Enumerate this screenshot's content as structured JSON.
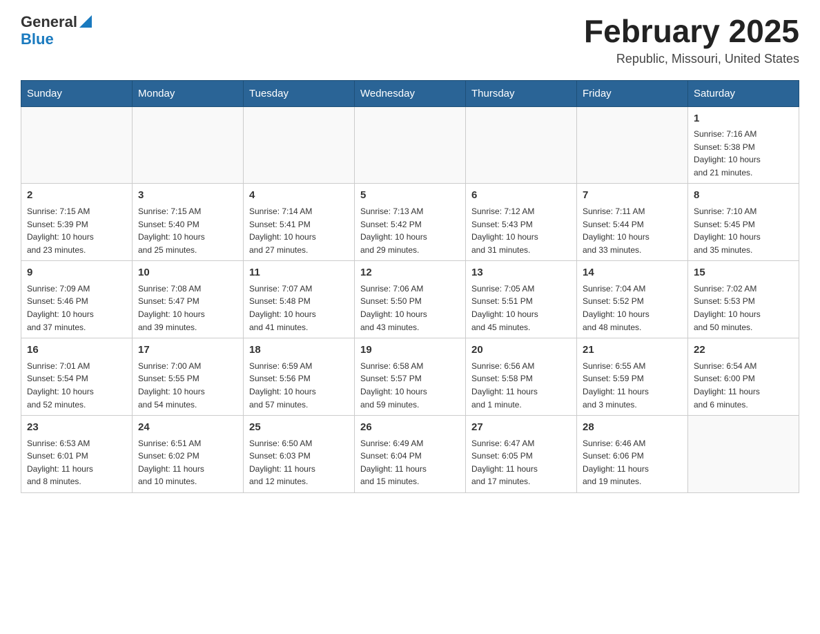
{
  "header": {
    "logo_general": "General",
    "logo_blue": "Blue",
    "title": "February 2025",
    "subtitle": "Republic, Missouri, United States"
  },
  "days_of_week": [
    "Sunday",
    "Monday",
    "Tuesday",
    "Wednesday",
    "Thursday",
    "Friday",
    "Saturday"
  ],
  "weeks": [
    [
      {
        "day": "",
        "info": ""
      },
      {
        "day": "",
        "info": ""
      },
      {
        "day": "",
        "info": ""
      },
      {
        "day": "",
        "info": ""
      },
      {
        "day": "",
        "info": ""
      },
      {
        "day": "",
        "info": ""
      },
      {
        "day": "1",
        "info": "Sunrise: 7:16 AM\nSunset: 5:38 PM\nDaylight: 10 hours\nand 21 minutes."
      }
    ],
    [
      {
        "day": "2",
        "info": "Sunrise: 7:15 AM\nSunset: 5:39 PM\nDaylight: 10 hours\nand 23 minutes."
      },
      {
        "day": "3",
        "info": "Sunrise: 7:15 AM\nSunset: 5:40 PM\nDaylight: 10 hours\nand 25 minutes."
      },
      {
        "day": "4",
        "info": "Sunrise: 7:14 AM\nSunset: 5:41 PM\nDaylight: 10 hours\nand 27 minutes."
      },
      {
        "day": "5",
        "info": "Sunrise: 7:13 AM\nSunset: 5:42 PM\nDaylight: 10 hours\nand 29 minutes."
      },
      {
        "day": "6",
        "info": "Sunrise: 7:12 AM\nSunset: 5:43 PM\nDaylight: 10 hours\nand 31 minutes."
      },
      {
        "day": "7",
        "info": "Sunrise: 7:11 AM\nSunset: 5:44 PM\nDaylight: 10 hours\nand 33 minutes."
      },
      {
        "day": "8",
        "info": "Sunrise: 7:10 AM\nSunset: 5:45 PM\nDaylight: 10 hours\nand 35 minutes."
      }
    ],
    [
      {
        "day": "9",
        "info": "Sunrise: 7:09 AM\nSunset: 5:46 PM\nDaylight: 10 hours\nand 37 minutes."
      },
      {
        "day": "10",
        "info": "Sunrise: 7:08 AM\nSunset: 5:47 PM\nDaylight: 10 hours\nand 39 minutes."
      },
      {
        "day": "11",
        "info": "Sunrise: 7:07 AM\nSunset: 5:48 PM\nDaylight: 10 hours\nand 41 minutes."
      },
      {
        "day": "12",
        "info": "Sunrise: 7:06 AM\nSunset: 5:50 PM\nDaylight: 10 hours\nand 43 minutes."
      },
      {
        "day": "13",
        "info": "Sunrise: 7:05 AM\nSunset: 5:51 PM\nDaylight: 10 hours\nand 45 minutes."
      },
      {
        "day": "14",
        "info": "Sunrise: 7:04 AM\nSunset: 5:52 PM\nDaylight: 10 hours\nand 48 minutes."
      },
      {
        "day": "15",
        "info": "Sunrise: 7:02 AM\nSunset: 5:53 PM\nDaylight: 10 hours\nand 50 minutes."
      }
    ],
    [
      {
        "day": "16",
        "info": "Sunrise: 7:01 AM\nSunset: 5:54 PM\nDaylight: 10 hours\nand 52 minutes."
      },
      {
        "day": "17",
        "info": "Sunrise: 7:00 AM\nSunset: 5:55 PM\nDaylight: 10 hours\nand 54 minutes."
      },
      {
        "day": "18",
        "info": "Sunrise: 6:59 AM\nSunset: 5:56 PM\nDaylight: 10 hours\nand 57 minutes."
      },
      {
        "day": "19",
        "info": "Sunrise: 6:58 AM\nSunset: 5:57 PM\nDaylight: 10 hours\nand 59 minutes."
      },
      {
        "day": "20",
        "info": "Sunrise: 6:56 AM\nSunset: 5:58 PM\nDaylight: 11 hours\nand 1 minute."
      },
      {
        "day": "21",
        "info": "Sunrise: 6:55 AM\nSunset: 5:59 PM\nDaylight: 11 hours\nand 3 minutes."
      },
      {
        "day": "22",
        "info": "Sunrise: 6:54 AM\nSunset: 6:00 PM\nDaylight: 11 hours\nand 6 minutes."
      }
    ],
    [
      {
        "day": "23",
        "info": "Sunrise: 6:53 AM\nSunset: 6:01 PM\nDaylight: 11 hours\nand 8 minutes."
      },
      {
        "day": "24",
        "info": "Sunrise: 6:51 AM\nSunset: 6:02 PM\nDaylight: 11 hours\nand 10 minutes."
      },
      {
        "day": "25",
        "info": "Sunrise: 6:50 AM\nSunset: 6:03 PM\nDaylight: 11 hours\nand 12 minutes."
      },
      {
        "day": "26",
        "info": "Sunrise: 6:49 AM\nSunset: 6:04 PM\nDaylight: 11 hours\nand 15 minutes."
      },
      {
        "day": "27",
        "info": "Sunrise: 6:47 AM\nSunset: 6:05 PM\nDaylight: 11 hours\nand 17 minutes."
      },
      {
        "day": "28",
        "info": "Sunrise: 6:46 AM\nSunset: 6:06 PM\nDaylight: 11 hours\nand 19 minutes."
      },
      {
        "day": "",
        "info": ""
      }
    ]
  ]
}
